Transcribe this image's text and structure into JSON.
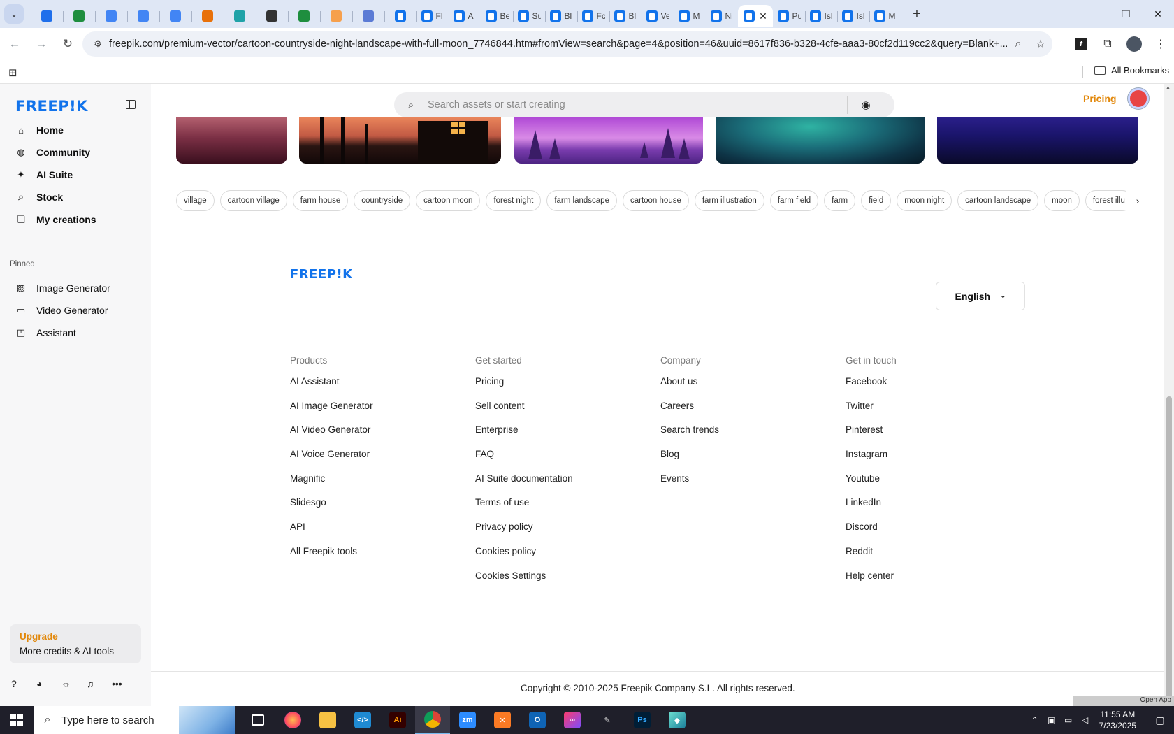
{
  "browser": {
    "tabs": [
      {
        "label": "",
        "icon": "wordpress-icon",
        "color": "#1f6feb"
      },
      {
        "label": "",
        "icon": "sheets-icon",
        "color": "#1e8e3e"
      },
      {
        "label": "",
        "icon": "docs-icon",
        "color": "#4285f4"
      },
      {
        "label": "",
        "icon": "docs-icon",
        "color": "#4285f4"
      },
      {
        "label": "",
        "icon": "docs-icon",
        "color": "#4285f4"
      },
      {
        "label": "",
        "icon": "orange-grid-icon",
        "color": "#e8710a"
      },
      {
        "label": "",
        "icon": "teal-ai-icon",
        "color": "#1fa2a8"
      },
      {
        "label": "",
        "icon": "openai-icon",
        "color": "#333333"
      },
      {
        "label": "",
        "icon": "sheets-icon",
        "color": "#1e8e3e"
      },
      {
        "label": "",
        "icon": "hand-icon",
        "color": "#f6a04d"
      },
      {
        "label": "",
        "icon": "grid-doc-icon",
        "color": "#5b7bd5"
      },
      {
        "label": "",
        "icon": "freepik-icon",
        "color": "#1273eb"
      },
      {
        "label": "Fl",
        "icon": "freepik-icon",
        "color": "#1273eb"
      },
      {
        "label": "A",
        "icon": "freepik-icon",
        "color": "#1273eb"
      },
      {
        "label": "Be",
        "icon": "freepik-icon",
        "color": "#1273eb"
      },
      {
        "label": "Su",
        "icon": "freepik-icon",
        "color": "#1273eb"
      },
      {
        "label": "Bl",
        "icon": "freepik-icon",
        "color": "#1273eb"
      },
      {
        "label": "Fc",
        "icon": "freepik-icon",
        "color": "#1273eb"
      },
      {
        "label": "Bl",
        "icon": "freepik-icon",
        "color": "#1273eb"
      },
      {
        "label": "Ve",
        "icon": "freepik-icon",
        "color": "#1273eb"
      },
      {
        "label": "M",
        "icon": "freepik-icon",
        "color": "#1273eb"
      },
      {
        "label": "Ni",
        "icon": "freepik-icon",
        "color": "#1273eb"
      },
      {
        "label": "",
        "icon": "freepik-icon",
        "color": "#1273eb",
        "active": true
      },
      {
        "label": "Pu",
        "icon": "freepik-icon",
        "color": "#1273eb"
      },
      {
        "label": "Isl",
        "icon": "freepik-icon",
        "color": "#1273eb"
      },
      {
        "label": "Isl",
        "icon": "freepik-icon",
        "color": "#1273eb"
      },
      {
        "label": "M",
        "icon": "freepik-icon",
        "color": "#1273eb"
      }
    ],
    "url": "freepik.com/premium-vector/cartoon-countryside-night-landscape-with-full-moon_7746844.htm#fromView=search&page=4&position=46&uuid=8617f836-b328-4cfe-aaa3-80cf2d119cc2&query=Blank+...",
    "all_bookmarks": "All Bookmarks"
  },
  "sidebar": {
    "logo": "FREEP!K",
    "nav": [
      {
        "label": "Home",
        "icon": "home-icon"
      },
      {
        "label": "Community",
        "icon": "globe-icon"
      },
      {
        "label": "AI Suite",
        "icon": "sparkle-icon"
      },
      {
        "label": "Stock",
        "icon": "search-icon"
      },
      {
        "label": "My creations",
        "icon": "creations-icon"
      }
    ],
    "pinned_title": "Pinned",
    "pinned": [
      {
        "label": "Image Generator",
        "icon": "image-icon"
      },
      {
        "label": "Video Generator",
        "icon": "video-icon"
      },
      {
        "label": "Assistant",
        "icon": "assistant-icon"
      }
    ],
    "upgrade_title": "Upgrade",
    "upgrade_sub": "More credits & AI tools"
  },
  "header": {
    "search_placeholder": "Search assets or start creating",
    "pricing": "Pricing"
  },
  "tags": [
    "village",
    "cartoon village",
    "farm house",
    "countryside",
    "cartoon moon",
    "forest night",
    "farm landscape",
    "cartoon house",
    "farm illustration",
    "farm field",
    "farm",
    "field",
    "moon night",
    "cartoon landscape",
    "moon",
    "forest illu"
  ],
  "footer": {
    "logo": "FREEP!K",
    "language": "English",
    "columns": [
      {
        "title": "Products",
        "links": [
          "AI Assistant",
          "AI Image Generator",
          "AI Video Generator",
          "AI Voice Generator",
          "Magnific",
          "Slidesgo",
          "API",
          "All Freepik tools"
        ]
      },
      {
        "title": "Get started",
        "links": [
          "Pricing",
          "Sell content",
          "Enterprise",
          "FAQ",
          "AI Suite documentation",
          "Terms of use",
          "Privacy policy",
          "Cookies policy",
          "Cookies Settings"
        ]
      },
      {
        "title": "Company",
        "links": [
          "About us",
          "Careers",
          "Search trends",
          "Blog",
          "Events"
        ]
      },
      {
        "title": "Get in touch",
        "links": [
          "Facebook",
          "Twitter",
          "Pinterest",
          "Instagram",
          "Youtube",
          "LinkedIn",
          "Discord",
          "Reddit",
          "Help center"
        ]
      }
    ],
    "copyright": "Copyright © 2010-2025 Freepik Company S.L. All rights reserved."
  },
  "overlay": {
    "open_app": "Open App"
  },
  "taskbar": {
    "search_text": "Type here to search",
    "time": "11:55 AM",
    "date": "7/23/2025"
  },
  "colors": {
    "brand": "#1273eb",
    "accent": "#e2880b"
  }
}
